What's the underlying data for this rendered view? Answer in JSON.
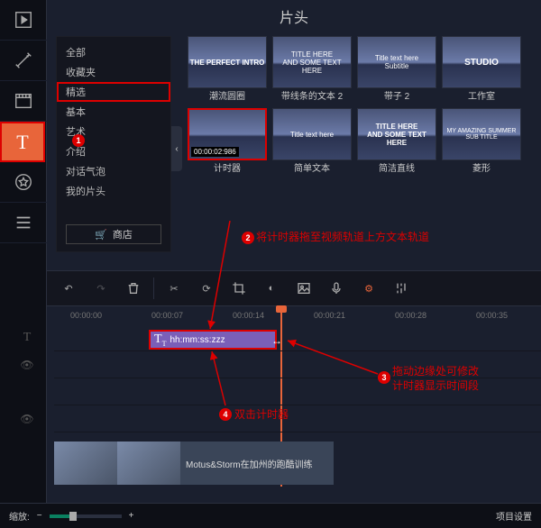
{
  "header": {
    "title": "片头"
  },
  "leftRail": [
    "video",
    "wand",
    "frame",
    "text",
    "star",
    "list"
  ],
  "categories": {
    "items": [
      "全部",
      "收藏夹",
      "精选",
      "基本",
      "艺术",
      "介绍",
      "对话气泡",
      "我的片头"
    ],
    "highlighted_index": 2,
    "store_label": "商店"
  },
  "templates": [
    {
      "label": "潮流圆圈",
      "thumb_text": "THE PERFECT INTRO"
    },
    {
      "label": "带线条的文本 2",
      "thumb_text": "TITLE HERE\nAND SOME TEXT HERE"
    },
    {
      "label": "带子 2",
      "thumb_text": "Title text here\nSubtitle"
    },
    {
      "label": "工作室",
      "thumb_text": "STUDIO"
    },
    {
      "label": "计时器",
      "thumb_text": "",
      "timecode": "00:00:02:986",
      "highlighted": true
    },
    {
      "label": "简单文本",
      "thumb_text": "Title text here"
    },
    {
      "label": "简洁直线",
      "thumb_text": "TITLE HERE\nAND SOME TEXT HERE"
    },
    {
      "label": "菱形",
      "thumb_text": "MY AMAZING SUMMER\nSUB TITLE"
    }
  ],
  "toolbar": {
    "buttons": [
      "undo",
      "redo",
      "delete",
      "sep",
      "cut",
      "rotate",
      "crop",
      "contrast",
      "image",
      "mic",
      "settings",
      "adjust"
    ]
  },
  "ruler": {
    "ticks": [
      "00:00:00",
      "00:00:07",
      "00:00:14",
      "00:00:21",
      "00:00:28",
      "00:00:35"
    ]
  },
  "tracks": {
    "text_icon": "T",
    "text_clip": {
      "label": "hh:mm:ss:zzz"
    },
    "video_clip": {
      "label": "Motus&Storm在加州的跑酷训练"
    }
  },
  "bottom": {
    "zoom_label": "缩放:",
    "project_settings": "项目设置"
  },
  "annotations": {
    "n1": "1",
    "n2": "2",
    "n2_text": "将计时器拖至视频轨道上方文本轨道",
    "n3": "3",
    "n3_text": "拖动边缘处可修改\n计时器显示时间段",
    "n4": "4",
    "n4_text": "双击计时器"
  }
}
